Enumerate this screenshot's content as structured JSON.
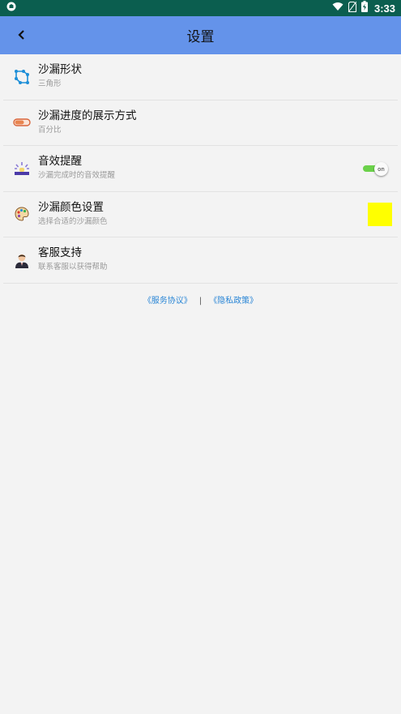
{
  "status_bar": {
    "time": "3:33"
  },
  "toolbar": {
    "title": "设置"
  },
  "settings": [
    {
      "title": "沙漏形状",
      "subtitle": "三角形",
      "icon": "shape-icon"
    },
    {
      "title": "沙漏进度的展示方式",
      "subtitle": "百分比",
      "icon": "progress-icon"
    },
    {
      "title": "音效提醒",
      "subtitle": "沙漏完成时的音效提醒",
      "icon": "sound-icon",
      "toggle": {
        "label": "on",
        "state": "on",
        "color": "#6bd14a"
      }
    },
    {
      "title": "沙漏颜色设置",
      "subtitle": "选择合适的沙漏颜色",
      "icon": "palette-icon",
      "swatch_color": "#ffff00"
    },
    {
      "title": "客服支持",
      "subtitle": "联系客服以获得帮助",
      "icon": "support-agent-icon"
    }
  ],
  "footer": {
    "service_link": "《服务协议》",
    "separator": "|",
    "privacy_link": "《隐私政策》"
  },
  "colors": {
    "status_bar": "#0b5e4f",
    "toolbar": "#6493ea",
    "link": "#2a86d6"
  }
}
